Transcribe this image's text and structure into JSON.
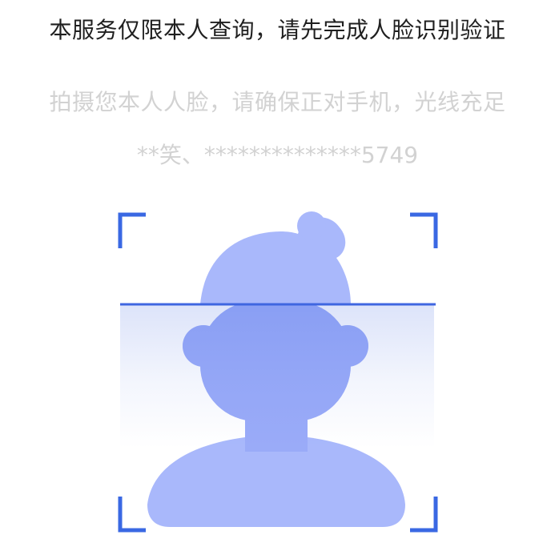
{
  "notice": {
    "title": "本服务仅限本人查询，请先完成人脸识别验证",
    "instruction": "拍摄您本人人脸，请确保正对手机，光线充足",
    "identity": "**笑、**************5749"
  },
  "scanner": {
    "illustration": "person-silhouette-icon",
    "colors": {
      "frame_corner": "#3a68e3",
      "scan_line": "#3f66e0",
      "silhouette": "#a9b8fb",
      "silhouette_overlay": "#8fa2f6"
    }
  }
}
